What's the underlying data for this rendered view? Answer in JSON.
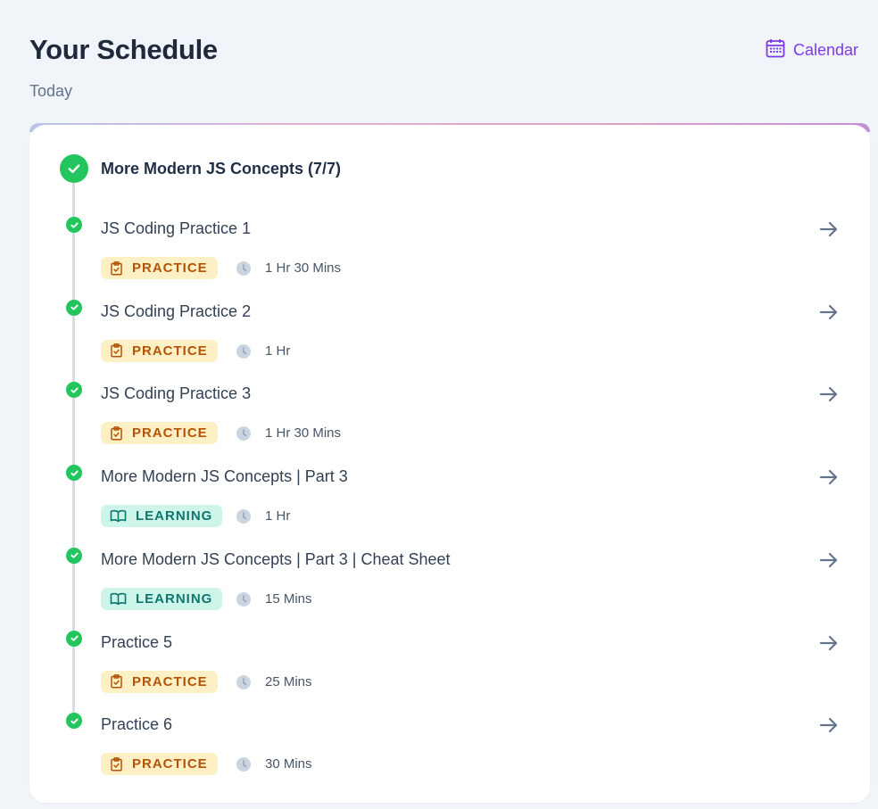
{
  "header": {
    "title": "Your Schedule",
    "subtitle": "Today",
    "calendar_label": "Calendar"
  },
  "group": {
    "title": "More Modern JS Concepts (7/7)"
  },
  "items": [
    {
      "title": "JS Coding Practice 1",
      "type": "PRACTICE",
      "duration": "1 Hr 30 Mins"
    },
    {
      "title": "JS Coding Practice 2",
      "type": "PRACTICE",
      "duration": "1 Hr"
    },
    {
      "title": "JS Coding Practice 3",
      "type": "PRACTICE",
      "duration": "1 Hr 30 Mins"
    },
    {
      "title": "More Modern JS Concepts | Part 3",
      "type": "LEARNING",
      "duration": "1 Hr"
    },
    {
      "title": "More Modern JS Concepts | Part 3 | Cheat Sheet",
      "type": "LEARNING",
      "duration": "15 Mins"
    },
    {
      "title": "Practice 5",
      "type": "PRACTICE",
      "duration": "25 Mins"
    },
    {
      "title": "Practice 6",
      "type": "PRACTICE",
      "duration": "30 Mins"
    }
  ],
  "colors": {
    "accent": "#7c3aed",
    "complete": "#22c55e",
    "practice_bg": "#fdf0c4",
    "practice_text": "#b45309",
    "learning_bg": "#cdf5ea",
    "learning_text": "#0f766e"
  },
  "icons": {
    "calendar": "calendar-icon",
    "check": "check-icon",
    "arrow": "arrow-right-icon",
    "practice": "clipboard-check-icon",
    "learning": "open-book-icon",
    "time": "clock-icon"
  }
}
